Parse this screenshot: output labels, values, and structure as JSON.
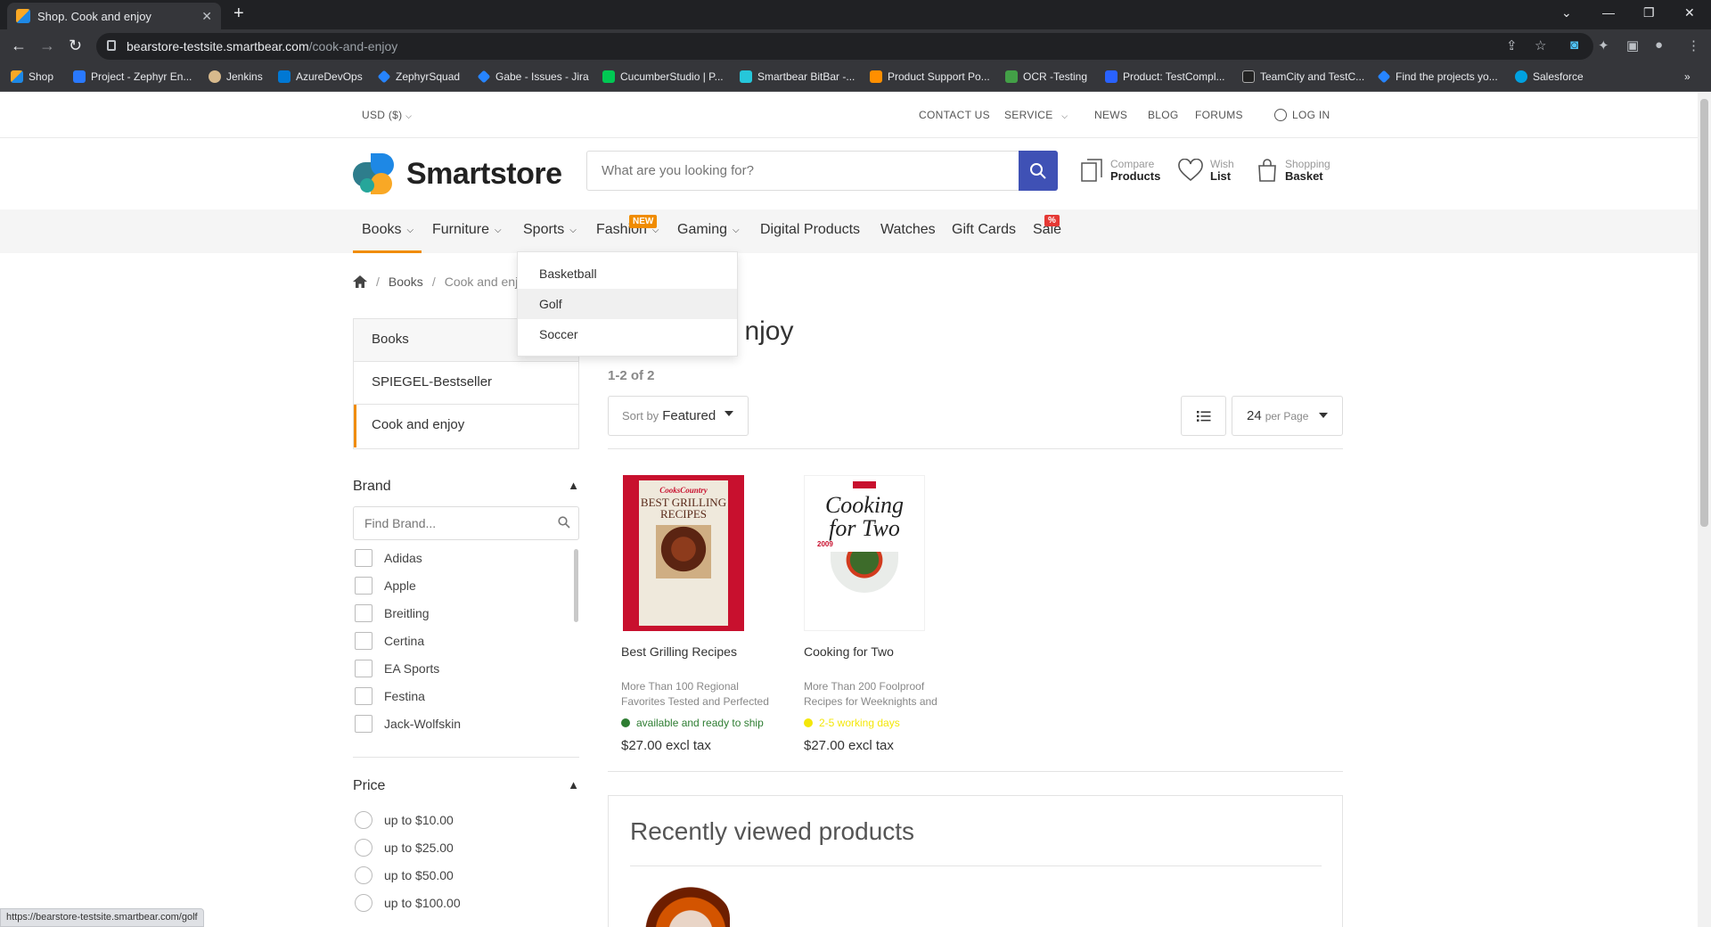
{
  "browser": {
    "tab_title": "Shop. Cook and enjoy",
    "url_host": "bearstore-testsite.smartbear.com",
    "url_path": "/cook-and-enjoy",
    "bookmarks": [
      "Shop",
      "Project - Zephyr En...",
      "Jenkins",
      "AzureDevOps",
      "ZephyrSquad",
      "Gabe - Issues - Jira",
      "CucumberStudio | P...",
      "Smartbear BitBar -...",
      "Product Support Po...",
      "OCR -Testing",
      "Product: TestCompl...",
      "TeamCity and TestC...",
      "Find the projects yo...",
      "Salesforce"
    ],
    "status_url": "https://bearstore-testsite.smartbear.com/golf"
  },
  "utility": {
    "currency": "USD  ($)",
    "contact": "CONTACT US",
    "service": "SERVICE",
    "news": "NEWS",
    "blog": "BLOG",
    "forums": "FORUMS",
    "login": "LOG IN"
  },
  "header": {
    "logo": "Smartstore",
    "search_placeholder": "What are you looking for?",
    "compare_small": "Compare",
    "compare_big": "Products",
    "wish_small": "Wish",
    "wish_big": "List",
    "basket_small": "Shopping",
    "basket_big": "Basket"
  },
  "nav": {
    "items": [
      "Books",
      "Furniture",
      "Sports",
      "Fashion",
      "Gaming",
      "Digital Products",
      "Watches",
      "Gift Cards",
      "Sale"
    ],
    "new_badge": "NEW",
    "sale_badge": "%",
    "sports_menu": [
      "Basketball",
      "Golf",
      "Soccer"
    ]
  },
  "breadcrumb": [
    "Books",
    "Cook and enjoy"
  ],
  "sidebar": {
    "categories": [
      "Books",
      "SPIEGEL-Bestseller",
      "Cook and enjoy"
    ],
    "brand_title": "Brand",
    "brand_placeholder": "Find Brand...",
    "brands": [
      "Adidas",
      "Apple",
      "Breitling",
      "Certina",
      "EA Sports",
      "Festina",
      "Jack-Wolfskin"
    ],
    "price_title": "Price",
    "prices": [
      "up to $10.00",
      "up to $25.00",
      "up to $50.00",
      "up to $100.00"
    ]
  },
  "main": {
    "title_visible": "njoy",
    "count": "1-2 of 2",
    "sort_label": "Sort by",
    "sort_value": "Featured",
    "per_page_value": "24",
    "per_page_label": "per Page",
    "products": [
      {
        "name": "Best Grilling Recipes",
        "desc": "More Than 100 Regional Favorites Tested and Perfected",
        "stock": "available and ready to ship",
        "stock_color": "#2e7d32",
        "price": "$27.00 excl tax",
        "cover_brand": "CooksCountry",
        "cover_title": "BEST GRILLING RECIPES"
      },
      {
        "name": "Cooking for Two",
        "desc": "More Than 200 Foolproof Recipes for Weeknights and",
        "stock": "2-5 working days",
        "stock_color": "#f4e70a",
        "price": "$27.00 excl tax",
        "cover_title": "Cooking for Two",
        "cover_year": "2009"
      }
    ],
    "recent_title": "Recently viewed products"
  },
  "colors": {
    "accent": "#f08c00",
    "brand_blue": "#3f51b5"
  }
}
